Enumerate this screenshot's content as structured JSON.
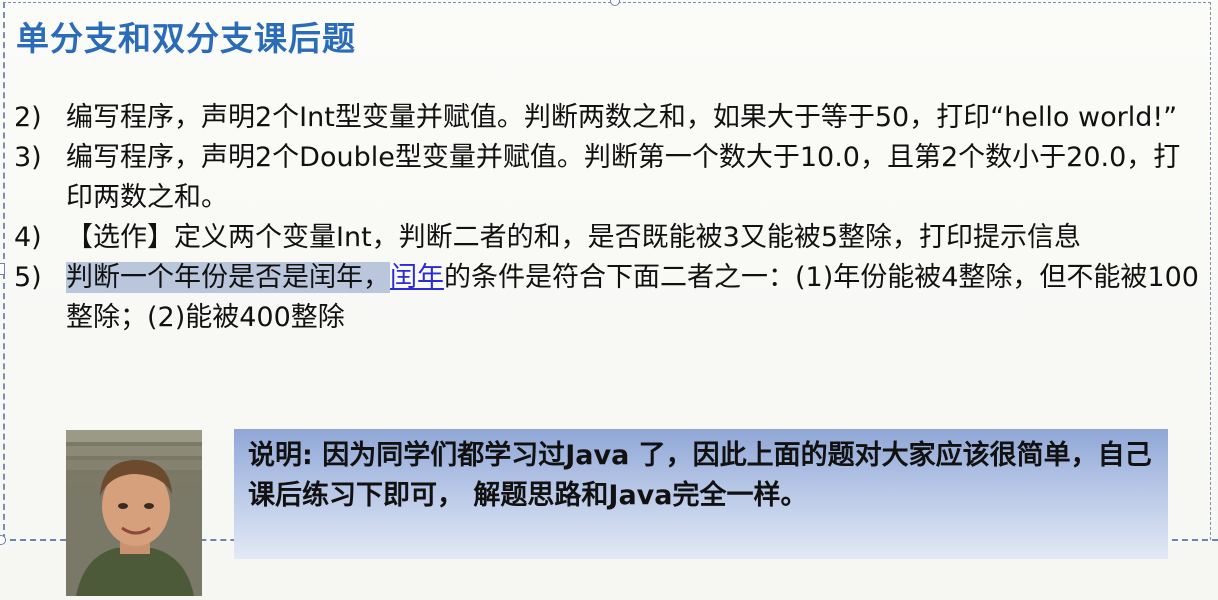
{
  "slide": {
    "title": "单分支和双分支课后题",
    "items": [
      {
        "num": "2)",
        "text": "编写程序，声明2个Int型变量并赋值。判断两数之和，如果大于等于50，打印“hello world!”"
      },
      {
        "num": "3)",
        "text": "编写程序，声明2个Double型变量并赋值。判断第一个数大于10.0，且第2个数小于20.0，打印两数之和。"
      },
      {
        "num": "4)",
        "text": "【选作】定义两个变量Int，判断二者的和，是否既能被3又能被5整除，打印提示信息"
      },
      {
        "num": "5)",
        "highlighted": "判断一个年份是否是闰年，",
        "link": "闰年",
        "rest": "的条件是符合下面二者之一：(1)年份能被4整除，但不能被100整除；(2)能被400整除"
      }
    ],
    "note": "说明: 因为同学们都学习过Java 了，因此上面的题对大家应该很简单，自己课后练习下即可， 解题思路和Java完全一样。"
  }
}
